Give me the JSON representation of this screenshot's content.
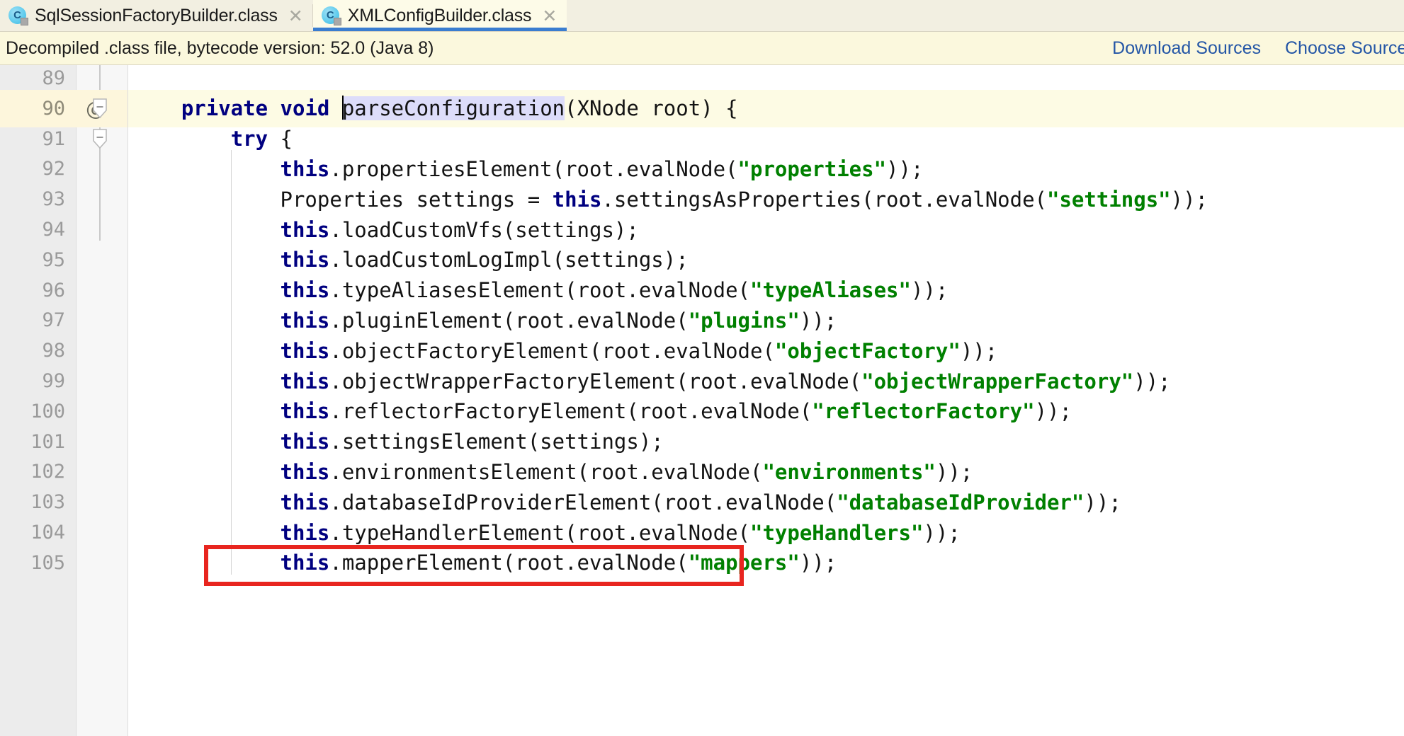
{
  "window": {
    "title": "XMLConfigBuilder.class"
  },
  "tabs": [
    {
      "label": "SqlSessionFactoryBuilder.class",
      "icon": "java-class-icon",
      "close": "✕",
      "active": false
    },
    {
      "label": "XMLConfigBuilder.class",
      "icon": "java-class-icon",
      "close": "✕",
      "active": true
    }
  ],
  "banner": {
    "message": "Decompiled .class file, bytecode version: 52.0 (Java 8)",
    "actions": [
      {
        "label": "Download Sources"
      },
      {
        "label": "Choose Sources..."
      }
    ],
    "link_color": "#2456a6",
    "background": "#fbf8dd"
  },
  "editor": {
    "current_line": 90,
    "caret_line": 90,
    "highlighted_identifier": "parseConfiguration",
    "lines": [
      {
        "number": "89",
        "annotation": "",
        "fold": "",
        "indent": 0,
        "tokens": []
      },
      {
        "number": "90",
        "annotation": "@",
        "fold": "collapse",
        "indent": 0,
        "tokens": [
          {
            "t": "    ",
            "c": "plain"
          },
          {
            "t": "private",
            "c": "kw"
          },
          {
            "t": " ",
            "c": "plain"
          },
          {
            "t": "void",
            "c": "kw"
          },
          {
            "t": " ",
            "c": "plain"
          },
          {
            "t": "CARET",
            "c": "caret"
          },
          {
            "t": "parseConfiguration",
            "c": "plain ident-hl"
          },
          {
            "t": "(XNode root) {",
            "c": "plain"
          }
        ]
      },
      {
        "number": "91",
        "annotation": "",
        "fold": "collapse",
        "indent": 0,
        "tokens": [
          {
            "t": "        ",
            "c": "plain"
          },
          {
            "t": "try",
            "c": "kw"
          },
          {
            "t": " {",
            "c": "plain"
          }
        ]
      },
      {
        "number": "92",
        "annotation": "",
        "fold": "",
        "indent": 1,
        "tokens": [
          {
            "t": "            ",
            "c": "plain"
          },
          {
            "t": "this",
            "c": "kw"
          },
          {
            "t": ".propertiesElement(root.evalNode(",
            "c": "plain"
          },
          {
            "t": "\"properties\"",
            "c": "str"
          },
          {
            "t": "));",
            "c": "plain"
          }
        ]
      },
      {
        "number": "93",
        "annotation": "",
        "fold": "",
        "indent": 1,
        "tokens": [
          {
            "t": "            Properties settings = ",
            "c": "plain"
          },
          {
            "t": "this",
            "c": "kw"
          },
          {
            "t": ".settingsAsProperties(root.evalNode(",
            "c": "plain"
          },
          {
            "t": "\"settings\"",
            "c": "str"
          },
          {
            "t": "));",
            "c": "plain"
          }
        ]
      },
      {
        "number": "94",
        "annotation": "",
        "fold": "",
        "indent": 1,
        "tokens": [
          {
            "t": "            ",
            "c": "plain"
          },
          {
            "t": "this",
            "c": "kw"
          },
          {
            "t": ".loadCustomVfs(settings);",
            "c": "plain"
          }
        ]
      },
      {
        "number": "95",
        "annotation": "",
        "fold": "",
        "indent": 1,
        "tokens": [
          {
            "t": "            ",
            "c": "plain"
          },
          {
            "t": "this",
            "c": "kw"
          },
          {
            "t": ".loadCustomLogImpl(settings);",
            "c": "plain"
          }
        ]
      },
      {
        "number": "96",
        "annotation": "",
        "fold": "",
        "indent": 1,
        "tokens": [
          {
            "t": "            ",
            "c": "plain"
          },
          {
            "t": "this",
            "c": "kw"
          },
          {
            "t": ".typeAliasesElement(root.evalNode(",
            "c": "plain"
          },
          {
            "t": "\"typeAliases\"",
            "c": "str"
          },
          {
            "t": "));",
            "c": "plain"
          }
        ]
      },
      {
        "number": "97",
        "annotation": "",
        "fold": "",
        "indent": 1,
        "tokens": [
          {
            "t": "            ",
            "c": "plain"
          },
          {
            "t": "this",
            "c": "kw"
          },
          {
            "t": ".pluginElement(root.evalNode(",
            "c": "plain"
          },
          {
            "t": "\"plugins\"",
            "c": "str"
          },
          {
            "t": "));",
            "c": "plain"
          }
        ]
      },
      {
        "number": "98",
        "annotation": "",
        "fold": "",
        "indent": 1,
        "tokens": [
          {
            "t": "            ",
            "c": "plain"
          },
          {
            "t": "this",
            "c": "kw"
          },
          {
            "t": ".objectFactoryElement(root.evalNode(",
            "c": "plain"
          },
          {
            "t": "\"objectFactory\"",
            "c": "str"
          },
          {
            "t": "));",
            "c": "plain"
          }
        ]
      },
      {
        "number": "99",
        "annotation": "",
        "fold": "",
        "indent": 1,
        "tokens": [
          {
            "t": "            ",
            "c": "plain"
          },
          {
            "t": "this",
            "c": "kw"
          },
          {
            "t": ".objectWrapperFactoryElement(root.evalNode(",
            "c": "plain"
          },
          {
            "t": "\"objectWrapperFactory\"",
            "c": "str"
          },
          {
            "t": "));",
            "c": "plain"
          }
        ]
      },
      {
        "number": "100",
        "annotation": "",
        "fold": "",
        "indent": 1,
        "tokens": [
          {
            "t": "            ",
            "c": "plain"
          },
          {
            "t": "this",
            "c": "kw"
          },
          {
            "t": ".reflectorFactoryElement(root.evalNode(",
            "c": "plain"
          },
          {
            "t": "\"reflectorFactory\"",
            "c": "str"
          },
          {
            "t": "));",
            "c": "plain"
          }
        ]
      },
      {
        "number": "101",
        "annotation": "",
        "fold": "",
        "indent": 1,
        "tokens": [
          {
            "t": "            ",
            "c": "plain"
          },
          {
            "t": "this",
            "c": "kw"
          },
          {
            "t": ".settingsElement(settings);",
            "c": "plain"
          }
        ]
      },
      {
        "number": "102",
        "annotation": "",
        "fold": "",
        "indent": 1,
        "tokens": [
          {
            "t": "            ",
            "c": "plain"
          },
          {
            "t": "this",
            "c": "kw"
          },
          {
            "t": ".environmentsElement(root.evalNode(",
            "c": "plain"
          },
          {
            "t": "\"environments\"",
            "c": "str"
          },
          {
            "t": "));",
            "c": "plain"
          }
        ]
      },
      {
        "number": "103",
        "annotation": "",
        "fold": "",
        "indent": 1,
        "tokens": [
          {
            "t": "            ",
            "c": "plain"
          },
          {
            "t": "this",
            "c": "kw"
          },
          {
            "t": ".databaseIdProviderElement(root.evalNode(",
            "c": "plain"
          },
          {
            "t": "\"databaseIdProvider\"",
            "c": "str"
          },
          {
            "t": "));",
            "c": "plain"
          }
        ]
      },
      {
        "number": "104",
        "annotation": "",
        "fold": "",
        "indent": 1,
        "tokens": [
          {
            "t": "            ",
            "c": "plain"
          },
          {
            "t": "this",
            "c": "kw"
          },
          {
            "t": ".typeHandlerElement(root.evalNode(",
            "c": "plain"
          },
          {
            "t": "\"typeHandlers\"",
            "c": "str"
          },
          {
            "t": "));",
            "c": "plain"
          }
        ]
      },
      {
        "number": "105",
        "annotation": "",
        "fold": "",
        "indent": 1,
        "tokens": [
          {
            "t": "            ",
            "c": "plain"
          },
          {
            "t": "this",
            "c": "kw"
          },
          {
            "t": ".mapperElement(root.evalNode(",
            "c": "plain"
          },
          {
            "t": "\"mappers\"",
            "c": "str"
          },
          {
            "t": "));",
            "c": "plain"
          }
        ]
      }
    ]
  },
  "annotation_box": {
    "color": "#e8251f",
    "target_line": "105",
    "target_text": "this.mapperElement(root.evalNode(\"mappers\"));"
  },
  "colors": {
    "keyword": "#000080",
    "string": "#008000",
    "text": "#131313",
    "line_number": "#9a9a9a",
    "current_line_bg": "#fdfbe4",
    "gutter_bg": "#ececec",
    "banner_bg": "#fbf8dd",
    "tab_active_bg": "#fdfbe8",
    "tab_inactive_bg": "#f2efe1",
    "tab_underline": "#3a7dd0",
    "identifier_highlight": "#ddddfa"
  }
}
